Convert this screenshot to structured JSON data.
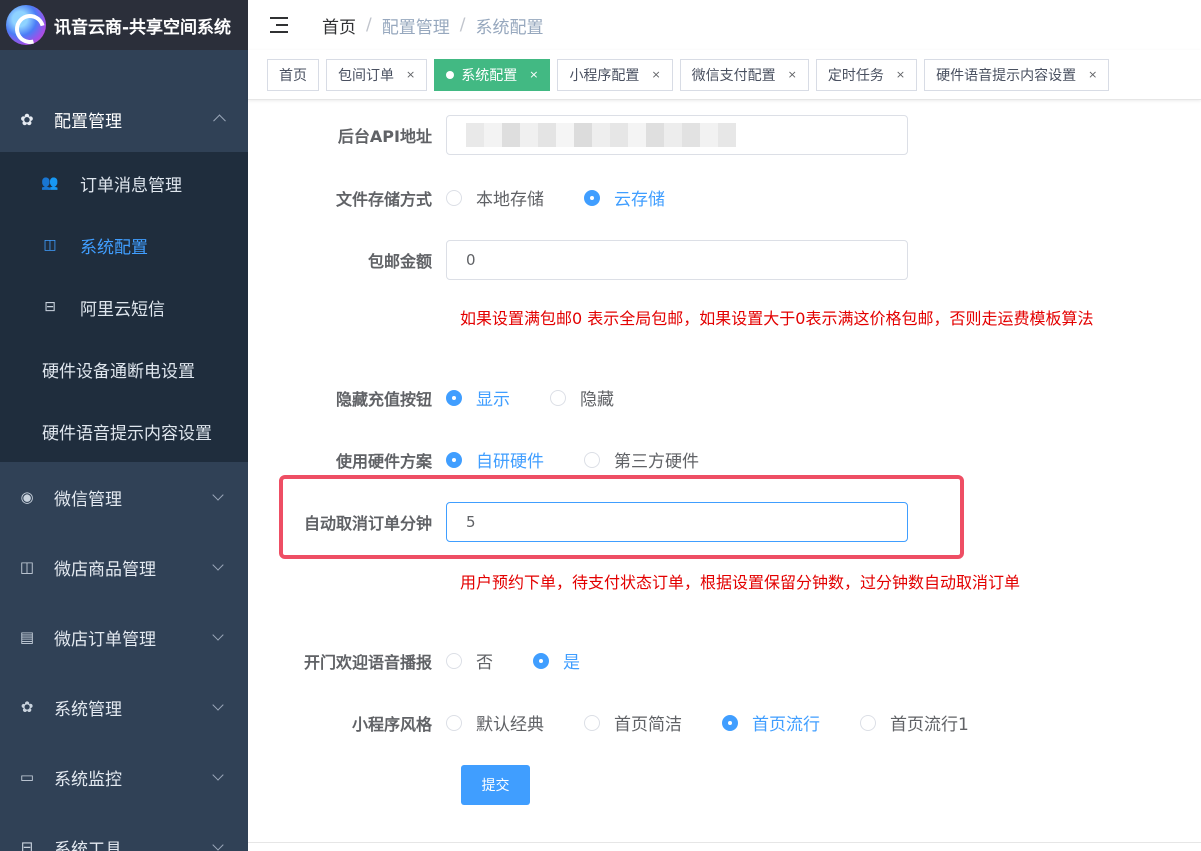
{
  "app": {
    "logo_text": "讯音云商-共享空间系统"
  },
  "sidebar": {
    "group": {
      "label": "配置管理",
      "icon": "gear-icon",
      "expanded": true
    },
    "sub_items": [
      {
        "label": "订单消息管理",
        "icon": "user-group-icon",
        "active": false
      },
      {
        "label": "系统配置",
        "icon": "shopping-bag-icon",
        "active": true
      },
      {
        "label": "阿里云短信",
        "icon": "briefcase-icon",
        "active": false
      },
      {
        "label": "硬件设备通断电设置",
        "icon": "",
        "active": false
      },
      {
        "label": "硬件语音提示内容设置",
        "icon": "",
        "active": false
      }
    ],
    "items": [
      {
        "label": "微信管理",
        "icon": "wechat-icon"
      },
      {
        "label": "微店商品管理",
        "icon": "shopping-bag-icon"
      },
      {
        "label": "微店订单管理",
        "icon": "document-icon"
      },
      {
        "label": "系统管理",
        "icon": "gear-icon"
      },
      {
        "label": "系统监控",
        "icon": "monitor-icon"
      },
      {
        "label": "系统工具",
        "icon": "toolbox-icon"
      }
    ]
  },
  "breadcrumb": [
    "首页",
    "配置管理",
    "系统配置"
  ],
  "tags": [
    {
      "label": "首页",
      "closable": false,
      "active": false
    },
    {
      "label": "包间订单",
      "closable": true,
      "active": false
    },
    {
      "label": "系统配置",
      "closable": true,
      "active": true
    },
    {
      "label": "小程序配置",
      "closable": true,
      "active": false
    },
    {
      "label": "微信支付配置",
      "closable": true,
      "active": false
    },
    {
      "label": "定时任务",
      "closable": true,
      "active": false
    },
    {
      "label": "硬件语音提示内容设置",
      "closable": true,
      "active": false
    }
  ],
  "form": {
    "api_url": {
      "label": "后台API地址",
      "value": ""
    },
    "storage": {
      "label": "文件存储方式",
      "options": [
        "本地存储",
        "云存储"
      ],
      "selected": "云存储"
    },
    "free_shipping": {
      "label": "包邮金额",
      "value": "0",
      "hint": "如果设置满包邮0 表示全局包邮，如果设置大于0表示满这价格包邮，否则走运费模板算法"
    },
    "hide_recharge": {
      "label": "隐藏充值按钮",
      "options": [
        "显示",
        "隐藏"
      ],
      "selected": "显示"
    },
    "hardware": {
      "label": "使用硬件方案",
      "options": [
        "自研硬件",
        "第三方硬件"
      ],
      "selected": "自研硬件"
    },
    "auto_cancel": {
      "label": "自动取消订单分钟",
      "value": "5",
      "hint": "用户预约下单，待支付状态订单，根据设置保留分钟数，过分钟数自动取消订单"
    },
    "welcome_voice": {
      "label": "开门欢迎语音播报",
      "options": [
        "否",
        "是"
      ],
      "selected": "是"
    },
    "style": {
      "label": "小程序风格",
      "options": [
        "默认经典",
        "首页简洁",
        "首页流行",
        "首页流行1"
      ],
      "selected": "首页流行"
    },
    "submit_label": "提交"
  },
  "colors": {
    "sidebar_bg": "#304156",
    "accent": "#409eff",
    "tag_active": "#42b983",
    "hint": "#e30000",
    "highlight": "#ee4e64"
  }
}
